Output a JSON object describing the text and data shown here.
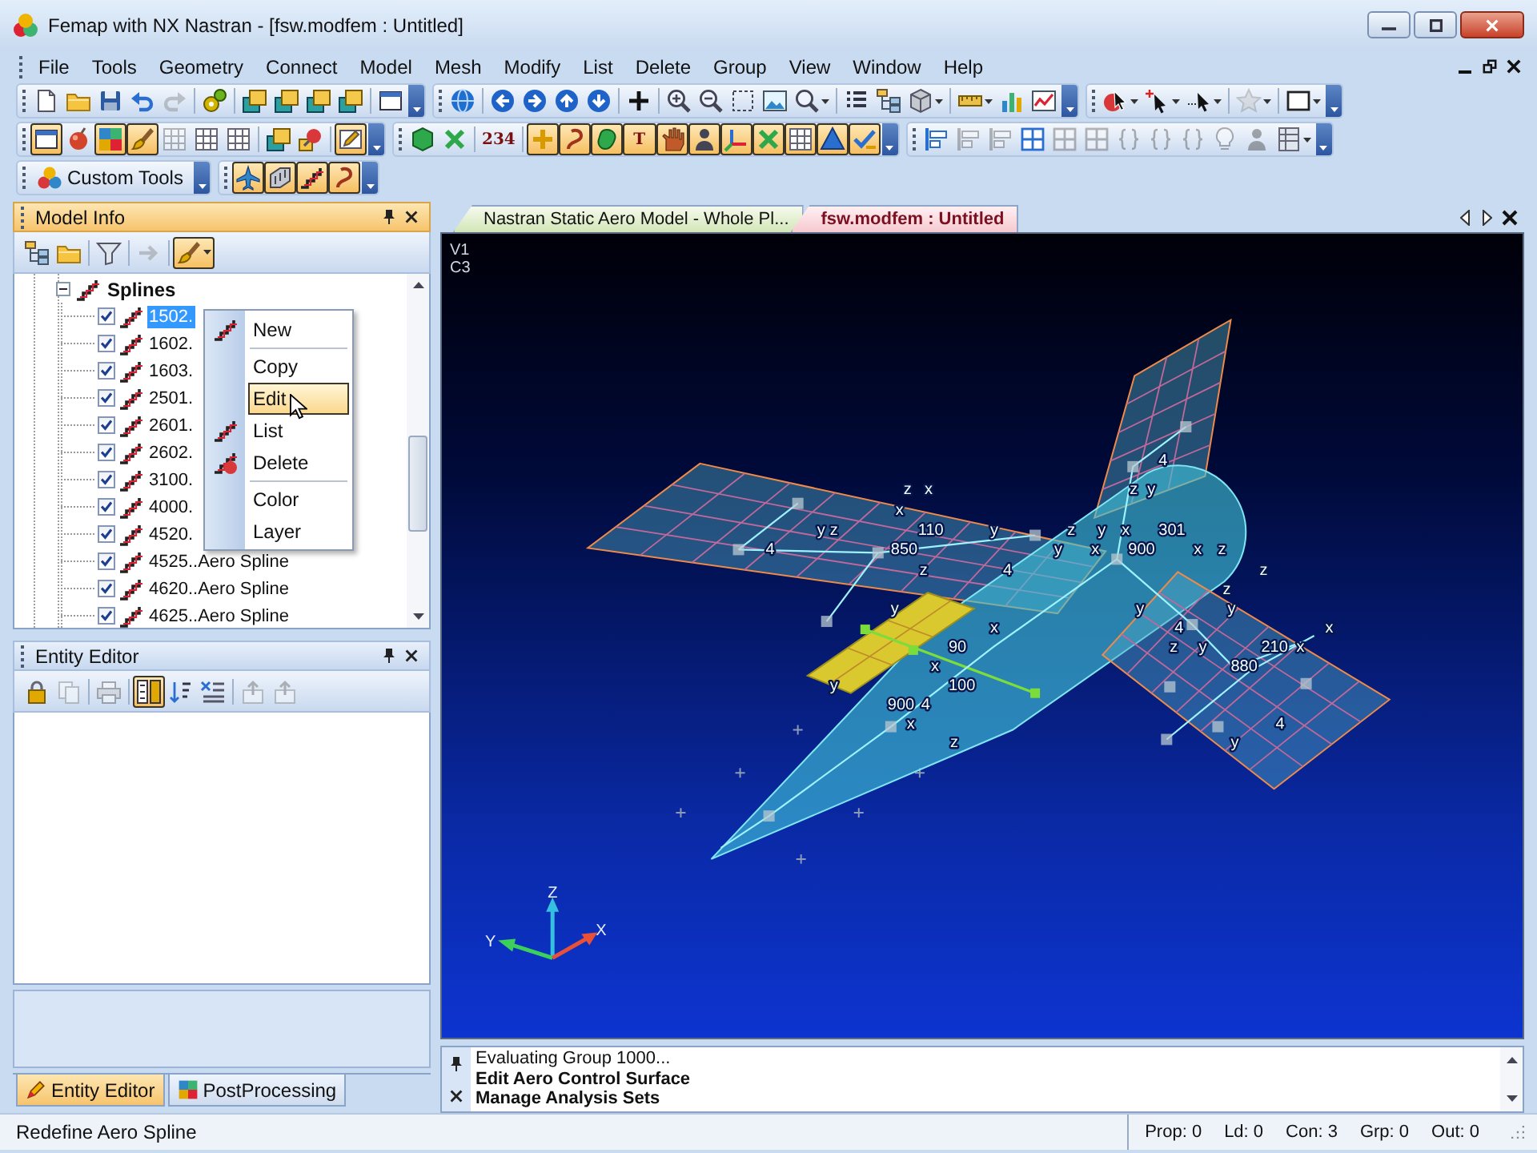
{
  "window": {
    "title": "Femap with NX Nastran - [fsw.modfem : Untitled]"
  },
  "menu_bar": {
    "items": [
      "File",
      "Tools",
      "Geometry",
      "Connect",
      "Model",
      "Mesh",
      "Modify",
      "List",
      "Delete",
      "Group",
      "View",
      "Window",
      "Help"
    ]
  },
  "toolbar_rows": [
    [
      {
        "items": [
          {
            "kind": "button",
            "pressed": false,
            "disabled": false
          },
          {
            "kind": "button",
            "pressed": false,
            "disabled": false
          },
          {
            "kind": "button",
            "pressed": false,
            "disabled": false
          },
          {
            "kind": "button",
            "pressed": false,
            "disabled": false
          },
          {
            "kind": "button",
            "pressed": false,
            "disabled": true
          },
          {
            "kind": "separator"
          },
          {
            "kind": "button",
            "pressed": false,
            "disabled": false
          },
          {
            "kind": "separator"
          },
          {
            "kind": "button",
            "pressed": false,
            "disabled": false
          },
          {
            "kind": "button",
            "pressed": false,
            "disabled": false
          },
          {
            "kind": "button",
            "pressed": false,
            "disabled": false
          },
          {
            "kind": "button",
            "pressed": false,
            "disabled": false
          },
          {
            "kind": "separator"
          },
          {
            "kind": "button",
            "pressed": false,
            "disabled": false
          }
        ]
      },
      {
        "items": [
          {
            "kind": "button",
            "pressed": false,
            "disabled": false
          },
          {
            "kind": "separator"
          },
          {
            "kind": "button",
            "pressed": false,
            "disabled": false
          },
          {
            "kind": "button",
            "pressed": false,
            "disabled": false
          },
          {
            "kind": "button",
            "pressed": false,
            "disabled": false
          },
          {
            "kind": "button",
            "pressed": false,
            "disabled": false
          },
          {
            "kind": "separator"
          },
          {
            "kind": "button",
            "pressed": false,
            "disabled": false
          },
          {
            "kind": "separator"
          },
          {
            "kind": "button",
            "pressed": false,
            "disabled": false
          },
          {
            "kind": "button",
            "pressed": false,
            "disabled": false
          },
          {
            "kind": "button",
            "pressed": false,
            "disabled": false
          },
          {
            "kind": "button",
            "pressed": false,
            "disabled": false
          },
          {
            "kind": "button",
            "pressed": false,
            "disabled": false
          },
          {
            "kind": "separator"
          },
          {
            "kind": "button",
            "pressed": false,
            "disabled": false
          },
          {
            "kind": "button",
            "pressed": false,
            "disabled": false
          },
          {
            "kind": "button",
            "pressed": false,
            "disabled": false
          },
          {
            "kind": "separator"
          },
          {
            "kind": "button",
            "pressed": false,
            "disabled": false
          },
          {
            "kind": "button",
            "pressed": false,
            "disabled": false
          },
          {
            "kind": "button",
            "pressed": false,
            "disabled": false
          }
        ]
      },
      {
        "items": [
          {
            "kind": "button",
            "pressed": false,
            "disabled": false
          },
          {
            "kind": "button",
            "pressed": false,
            "disabled": false
          },
          {
            "kind": "button",
            "pressed": false,
            "disabled": false
          },
          {
            "kind": "separator"
          },
          {
            "kind": "button",
            "pressed": false,
            "disabled": true
          },
          {
            "kind": "separator"
          },
          {
            "kind": "button",
            "pressed": false,
            "disabled": false
          }
        ]
      }
    ],
    [
      {
        "items": [
          {
            "kind": "button",
            "pressed": true,
            "disabled": false
          },
          {
            "kind": "button",
            "pressed": false,
            "disabled": false
          },
          {
            "kind": "button",
            "pressed": true,
            "disabled": false
          },
          {
            "kind": "button",
            "pressed": true,
            "disabled": false
          },
          {
            "kind": "button",
            "pressed": false,
            "disabled": true
          },
          {
            "kind": "button",
            "pressed": false,
            "disabled": false
          },
          {
            "kind": "button",
            "pressed": false,
            "disabled": false
          },
          {
            "kind": "separator"
          },
          {
            "kind": "button",
            "pressed": false,
            "disabled": false
          },
          {
            "kind": "button",
            "pressed": false,
            "disabled": false
          },
          {
            "kind": "separator"
          },
          {
            "kind": "button",
            "pressed": true,
            "disabled": false
          }
        ]
      },
      {
        "items": [
          {
            "kind": "button",
            "pressed": false,
            "disabled": false
          },
          {
            "kind": "button",
            "pressed": false,
            "disabled": false
          },
          {
            "kind": "separator"
          },
          {
            "kind": "glyph",
            "label": "234",
            "pressed": false,
            "disabled": false
          },
          {
            "kind": "separator"
          },
          {
            "kind": "button",
            "pressed": true,
            "disabled": false
          },
          {
            "kind": "button",
            "pressed": true,
            "disabled": false
          },
          {
            "kind": "button",
            "pressed": true,
            "disabled": false
          },
          {
            "kind": "glyph",
            "label": "T",
            "pressed": true,
            "disabled": false
          },
          {
            "kind": "button",
            "pressed": true,
            "disabled": false
          },
          {
            "kind": "button",
            "pressed": true,
            "disabled": false
          },
          {
            "kind": "button",
            "pressed": true,
            "disabled": false
          },
          {
            "kind": "button",
            "pressed": true,
            "disabled": false
          },
          {
            "kind": "button",
            "pressed": true,
            "disabled": false
          },
          {
            "kind": "button",
            "pressed": true,
            "disabled": false
          },
          {
            "kind": "button",
            "pressed": true,
            "disabled": false
          }
        ]
      },
      {
        "items": [
          {
            "kind": "button",
            "pressed": false,
            "disabled": false
          },
          {
            "kind": "button",
            "pressed": false,
            "disabled": true
          },
          {
            "kind": "button",
            "pressed": false,
            "disabled": true
          },
          {
            "kind": "button",
            "pressed": false,
            "disabled": false
          },
          {
            "kind": "button",
            "pressed": false,
            "disabled": true
          },
          {
            "kind": "button",
            "pressed": false,
            "disabled": true
          },
          {
            "kind": "button",
            "pressed": false,
            "disabled": true
          },
          {
            "kind": "button",
            "pressed": false,
            "disabled": true
          },
          {
            "kind": "button",
            "pressed": false,
            "disabled": true
          },
          {
            "kind": "button",
            "pressed": false,
            "disabled": true
          },
          {
            "kind": "button",
            "pressed": false,
            "disabled": true
          },
          {
            "kind": "button",
            "pressed": false,
            "disabled": false
          }
        ]
      }
    ],
    [
      {
        "items": [
          {
            "kind": "text_button",
            "label": "Custom Tools",
            "pressed": false,
            "disabled": false
          }
        ]
      },
      {
        "items": [
          {
            "kind": "button",
            "pressed": true,
            "disabled": false
          },
          {
            "kind": "button",
            "pressed": true,
            "disabled": false
          },
          {
            "kind": "button",
            "pressed": true,
            "disabled": false
          },
          {
            "kind": "button",
            "pressed": true,
            "disabled": false
          }
        ]
      }
    ]
  ],
  "model_info": {
    "title": "Model Info",
    "toolbar": [
      {
        "kind": "button",
        "pressed": false,
        "disabled": false
      },
      {
        "kind": "button",
        "pressed": false,
        "disabled": false
      },
      {
        "kind": "separator"
      },
      {
        "kind": "button",
        "pressed": false,
        "disabled": false
      },
      {
        "kind": "separator"
      },
      {
        "kind": "button",
        "pressed": false,
        "disabled": true
      },
      {
        "kind": "separator"
      },
      {
        "kind": "button",
        "pressed": true,
        "disabled": false
      }
    ],
    "tree": {
      "label": "Splines",
      "expanded": true,
      "children": [
        {
          "label": "1502.",
          "checked": true,
          "selected": true
        },
        {
          "label": "1602.",
          "checked": true,
          "selected": false
        },
        {
          "label": "1603.",
          "checked": true,
          "selected": false
        },
        {
          "label": "2501.",
          "checked": true,
          "selected": false
        },
        {
          "label": "2601.",
          "checked": true,
          "selected": false
        },
        {
          "label": "2602.",
          "checked": true,
          "selected": false
        },
        {
          "label": "3100.",
          "checked": true,
          "selected": false
        },
        {
          "label": "4000.",
          "checked": true,
          "selected": false
        },
        {
          "label": "4520.",
          "checked": true,
          "selected": false
        },
        {
          "label": "4525..Aero Spline",
          "checked": true,
          "selected": false
        },
        {
          "label": "4620..Aero Spline",
          "checked": true,
          "selected": false
        },
        {
          "label": "4625..Aero Spline",
          "checked": true,
          "selected": false
        }
      ]
    },
    "context_menu": {
      "items": [
        {
          "kind": "item",
          "label": "New",
          "selected": false
        },
        {
          "kind": "separator"
        },
        {
          "kind": "item",
          "label": "Copy",
          "selected": false
        },
        {
          "kind": "item",
          "label": "Edit",
          "selected": true
        },
        {
          "kind": "item",
          "label": "List",
          "selected": false
        },
        {
          "kind": "item",
          "label": "Delete",
          "selected": false
        },
        {
          "kind": "separator"
        },
        {
          "kind": "item",
          "label": "Color",
          "selected": false
        },
        {
          "kind": "item",
          "label": "Layer",
          "selected": false
        }
      ]
    }
  },
  "entity_editor": {
    "title": "Entity Editor",
    "toolbar": [
      {
        "kind": "button",
        "pressed": false,
        "disabled": false
      },
      {
        "kind": "button",
        "pressed": false,
        "disabled": true
      },
      {
        "kind": "separator"
      },
      {
        "kind": "button",
        "pressed": false,
        "disabled": true
      },
      {
        "kind": "separator"
      },
      {
        "kind": "button",
        "pressed": true,
        "disabled": false
      },
      {
        "kind": "button",
        "pressed": false,
        "disabled": false
      },
      {
        "kind": "button",
        "pressed": false,
        "disabled": false
      },
      {
        "kind": "separator"
      },
      {
        "kind": "button",
        "pressed": false,
        "disabled": true
      },
      {
        "kind": "button",
        "pressed": false,
        "disabled": true
      }
    ]
  },
  "panel_tabs": [
    {
      "label": "Entity Editor",
      "selected": true
    },
    {
      "label": "PostProcessing",
      "selected": false
    }
  ],
  "document_tabs": [
    {
      "label": "Nastran Static Aero Model - Whole Pl...",
      "selected": false
    },
    {
      "label": "fsw.modfem : Untitled",
      "selected": true
    }
  ],
  "viewport": {
    "view_labels": [
      "V1",
      "C3"
    ],
    "model_labels": [
      "4",
      "z",
      "x",
      "z",
      "y",
      "x",
      "y",
      "z",
      "110",
      "y",
      "z",
      "y",
      "x",
      "301",
      "4",
      "850",
      "y",
      "x",
      "900",
      "x",
      "z",
      "z",
      "4",
      "z",
      "z",
      "y",
      "y",
      "y",
      "x",
      "4",
      "x",
      "90",
      "z",
      "y",
      "210",
      "x",
      "x",
      "880",
      "y",
      "100",
      "900",
      "4",
      "x",
      "4",
      "z",
      "y"
    ],
    "axis_labels": [
      "Z",
      "Y",
      "X"
    ]
  },
  "messages": [
    {
      "kind": "status",
      "text": "Evaluating Group 1000..."
    },
    {
      "kind": "command",
      "text": "Edit Aero Control Surface"
    },
    {
      "kind": "command",
      "text": "Manage Analysis Sets"
    }
  ],
  "status_bar": {
    "text": "Redefine Aero Spline",
    "fields": [
      "Prop: 0",
      "Ld: 0",
      "Con: 3",
      "Grp: 0",
      "Out: 0"
    ]
  }
}
